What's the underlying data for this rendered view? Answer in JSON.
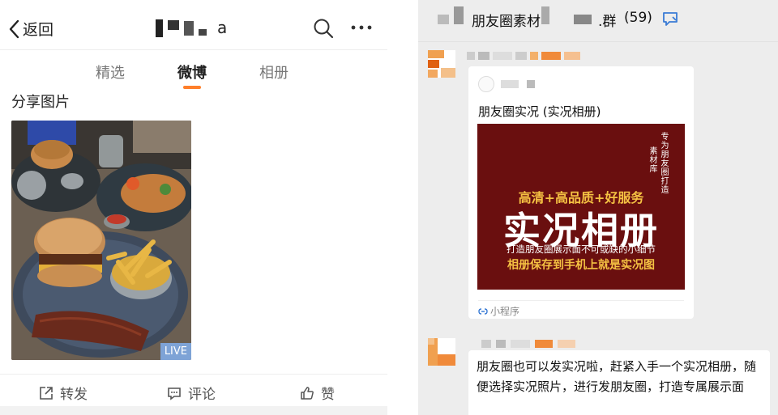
{
  "left": {
    "back_label": "返回",
    "title_suffix": "a",
    "tabs": [
      {
        "label": "精选",
        "active": false
      },
      {
        "label": "微博",
        "active": true
      },
      {
        "label": "相册",
        "active": false
      }
    ],
    "section_title": "分享图片",
    "live_badge": "LIVE",
    "actions": {
      "repost": "转发",
      "comment": "评论",
      "like": "赞"
    },
    "accent_color": "#ff7f2a"
  },
  "right": {
    "chat_title": "朋友圈素材",
    "chat_title_tail": ".群",
    "member_count": "(59)",
    "card": {
      "title": "朋友圈实况 (实况相册)",
      "poster": {
        "vertical_left": "素材库",
        "vertical_right": "专为朋友圈打造",
        "line1": "高清+高品质+好服务",
        "headline": "实况相册",
        "line3": "打造朋友圈展示面不可或缺的小细节",
        "line4": "相册保存到手机上就是实况图"
      },
      "footer": "小程序"
    },
    "message": "朋友圈也可以发实况啦，赶紧入手一个实况相册，随便选择实况照片，进行发朋友圈，打造专属展示面"
  }
}
